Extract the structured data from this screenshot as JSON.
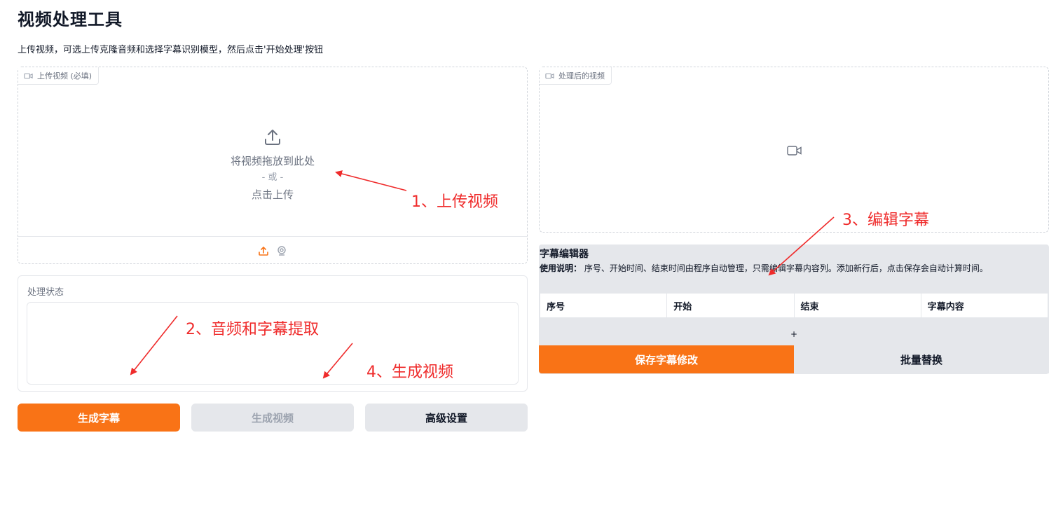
{
  "page": {
    "title": "视频处理工具",
    "description": "上传视频，可选上传克隆音频和选择字幕识别模型，然后点击'开始处理'按钮"
  },
  "upload": {
    "label": "上传视频 (必填)",
    "drop_text": "将视频拖放到此处",
    "or_text": "- 或 -",
    "click_text": "点击上传",
    "icons": [
      "video-icon",
      "upload-icon",
      "webcam-icon"
    ]
  },
  "output": {
    "label": "处理后的视频",
    "icon": "video-icon"
  },
  "status": {
    "label": "处理状态",
    "value": ""
  },
  "buttons": {
    "generate_subtitles": "生成字幕",
    "generate_video": "生成视频",
    "advanced_settings": "高级设置"
  },
  "editor": {
    "title": "字幕编辑器",
    "help_label": "使用说明：",
    "help_text": " 序号、开始时间、结束时间由程序自动管理，只需编辑字幕内容列。添加新行后，点击保存会自动计算时间。",
    "columns": [
      "序号",
      "开始",
      "结束",
      "字幕内容"
    ],
    "add_row": "+",
    "save_button": "保存字幕修改",
    "replace_button": "批量替换"
  },
  "annotations": {
    "step1": "1、上传视频",
    "step2": "2、音频和字幕提取",
    "step3": "3、编辑字幕",
    "step4": "4、生成视频"
  },
  "colors": {
    "accent": "#f97316",
    "annotation": "#ef2b2b",
    "panel_bg": "#e5e7eb"
  }
}
